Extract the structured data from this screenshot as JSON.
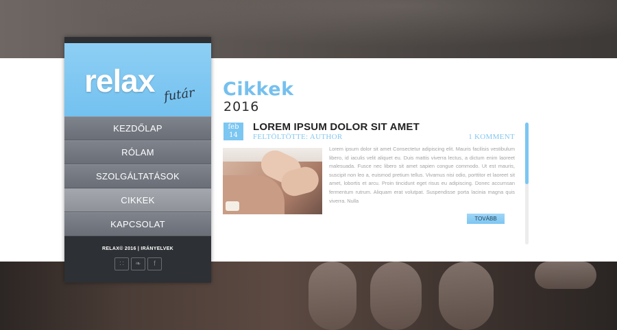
{
  "logo": {
    "main": "relax",
    "sub": "futár"
  },
  "nav": [
    {
      "label": "KEZDŐLAP",
      "active": false
    },
    {
      "label": "RÓLAM",
      "active": false
    },
    {
      "label": "SZOLGÁLTATÁSOK",
      "active": false
    },
    {
      "label": "CIKKEK",
      "active": true
    },
    {
      "label": "KAPCSOLAT",
      "active": false
    }
  ],
  "footer": {
    "text": "RELAX© 2016 | IRÁNYELVEK",
    "socials": [
      {
        "icon": "rss-icon",
        "glyph": "∷"
      },
      {
        "icon": "twitter-icon",
        "glyph": "❧"
      },
      {
        "icon": "facebook-icon",
        "glyph": "f"
      }
    ]
  },
  "page": {
    "title": "Cikkek",
    "year": "2016"
  },
  "post": {
    "date_month": "feb",
    "date_day": "14",
    "title": "LOREM IPSUM DOLOR SIT AMET",
    "author": "FELTÖLTÖTTE: AUTHOR",
    "comments": "1 KOMMENT",
    "body": "Lorem ipsum dolor sit amet Consectetur adipiscing elit. Mauris facilisis vestibulum libero, id iaculis velit aliquet eu. Duis mattis viverra lectus, a dictum enim laoreet malesuada. Fusce nec libero sit amet sapien congue commodo. Ut est mauris, suscipit non leo a, euismod pretium tellus. Vivamus nisi odio, porttitor et laoreet sit amet, lobortis et arcu. Proin tincidunt eget risus eu adipiscing. Donec accumsan fermentum rutrum. Aliquam erat volutpat. Suspendisse porta lacinia magna quis viverra. Nulla",
    "more_label": "TOVÁBB"
  },
  "colors": {
    "accent": "#7cc6f2",
    "nav": "#767a83",
    "nav_active": "#9a9ea4",
    "sidebar_dark": "#2d3034"
  }
}
